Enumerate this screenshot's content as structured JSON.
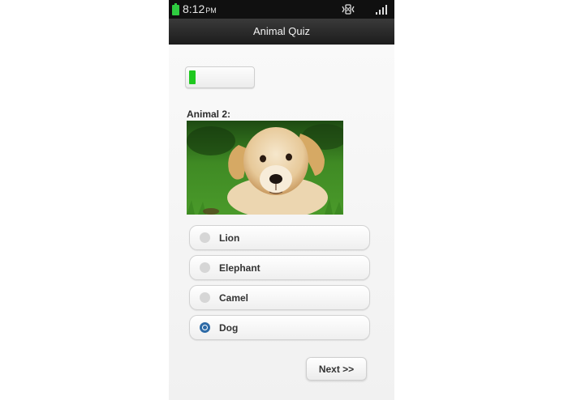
{
  "status_bar": {
    "time": "8:12",
    "ampm": "PM"
  },
  "app": {
    "title": "Animal Quiz"
  },
  "quiz": {
    "progress_fraction": 0.1,
    "progress_color": "#1fc81f",
    "question_label": "Animal 2:",
    "options": [
      {
        "label": "Lion",
        "selected": false
      },
      {
        "label": "Elephant",
        "selected": false
      },
      {
        "label": "Camel",
        "selected": false
      },
      {
        "label": "Dog",
        "selected": true
      }
    ],
    "next_label": "Next >>"
  }
}
